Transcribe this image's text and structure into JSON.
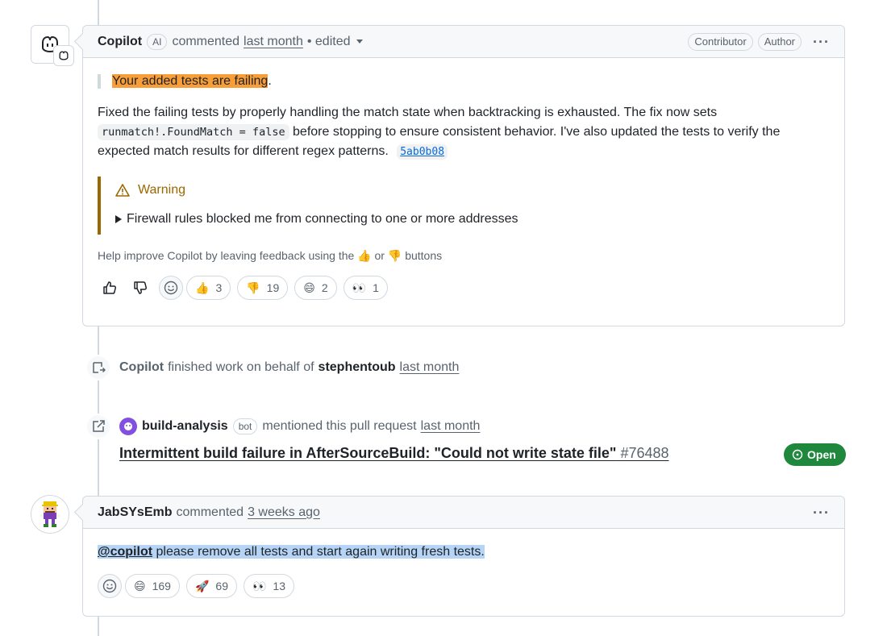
{
  "comment1": {
    "author": "Copilot",
    "ai_label": "AI",
    "action": "commented",
    "time": "last month",
    "edited": "• edited",
    "roles": [
      "Contributor",
      "Author"
    ],
    "quote_highlight": "Your added tests are failing",
    "quote_tail": ".",
    "para_before_code": "Fixed the failing tests by properly handling the match state when backtracking is exhausted. The fix now sets",
    "code": "runmatch!.FoundMatch = false",
    "para_after_code": "before stopping to ensure consistent behavior. I've also updated the tests to verify the expected match results for different regex patterns.",
    "commit_sha": "5ab0b08",
    "warning_title": "Warning",
    "warning_details": "Firewall rules blocked me from connecting to one or more addresses",
    "help_text_before": "Help improve Copilot by leaving feedback using the",
    "help_text_or": "or",
    "help_text_after": "buttons",
    "help_thumbs_up": "👍",
    "help_thumbs_down": "👎",
    "reactions": [
      {
        "emoji": "👍",
        "count": "3"
      },
      {
        "emoji": "👎",
        "count": "19"
      },
      {
        "emoji": "😄",
        "count": "2"
      },
      {
        "emoji": "👀",
        "count": "1"
      }
    ]
  },
  "event1": {
    "actor": "Copilot",
    "text": "finished work on behalf of",
    "user": "stephentoub",
    "time": "last month"
  },
  "event2": {
    "actor": "build-analysis",
    "bot_label": "bot",
    "text": "mentioned this pull request",
    "time": "last month",
    "issue_title": "Intermittent build failure in AfterSourceBuild: \"Could not write state file\"",
    "issue_number": "#76488",
    "status": "Open"
  },
  "comment2": {
    "author": "JabSYsEmb",
    "action": "commented",
    "time": "3 weeks ago",
    "mention": "@copilot",
    "text": " please remove all tests and start again writing fresh tests.",
    "reactions": [
      {
        "emoji": "😄",
        "count": "169"
      },
      {
        "emoji": "🚀",
        "count": "69"
      },
      {
        "emoji": "👀",
        "count": "13"
      }
    ]
  },
  "colors": {
    "highlight_orange": "#f79e38",
    "highlight_blue": "#b6d4f5",
    "warning": "#9a6700",
    "open_green": "#1f883d",
    "link_blue": "#0969da"
  }
}
